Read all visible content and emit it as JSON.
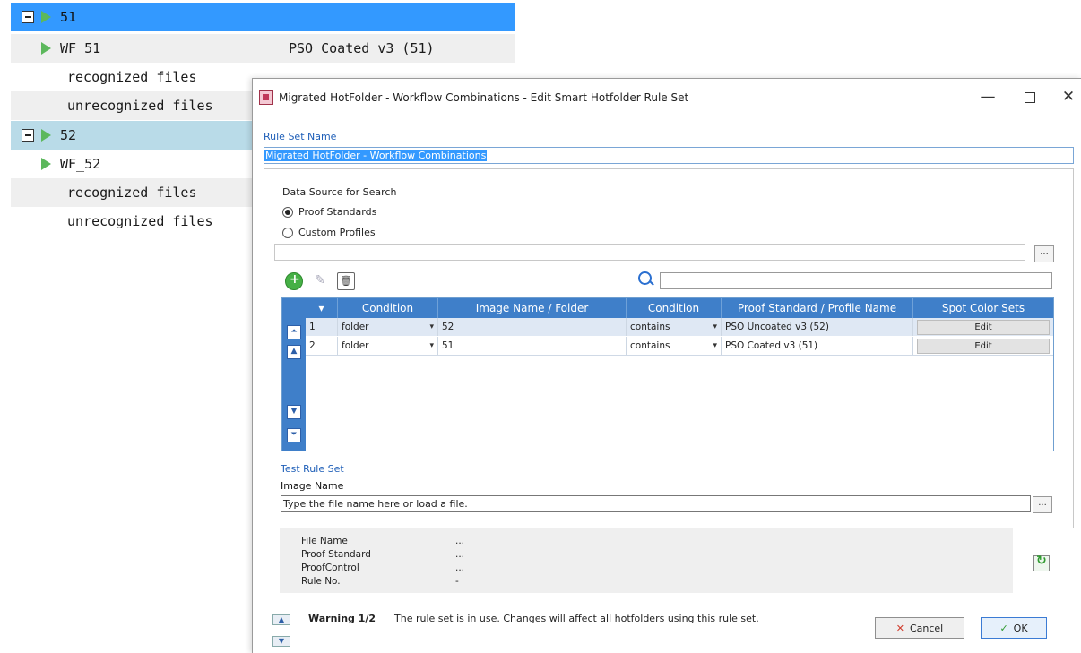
{
  "tree": {
    "rows": [
      {
        "label": "51",
        "value": ""
      },
      {
        "label": "WF_51",
        "value": "PSO Coated v3 (51)"
      },
      {
        "label": "recognized files"
      },
      {
        "label": "unrecognized files"
      },
      {
        "label": "52"
      },
      {
        "label": "WF_52"
      },
      {
        "label": "recognized files"
      },
      {
        "label": "unrecognized files"
      }
    ]
  },
  "dialog": {
    "title": "Migrated HotFolder - Workflow Combinations - Edit Smart Hotfolder Rule Set",
    "minimize": "—",
    "close": "✕",
    "rule_set_name_label": "Rule Set Name",
    "rule_set_name_value": "Migrated HotFolder - Workflow Combinations",
    "data_source_label": "Data Source for Search",
    "radio_proof_standards": "Proof Standards",
    "radio_custom_profiles": "Custom Profiles",
    "dots": "...",
    "grid": {
      "headers": [
        "Condition",
        "Image Name / Folder",
        "Condition",
        "Proof Standard / Profile Name",
        "Spot Color Sets"
      ],
      "rows": [
        {
          "num": "1",
          "cond1": "folder",
          "name": "52",
          "cond2": "contains",
          "proof": "PSO Uncoated v3 (52)",
          "edit": "Edit"
        },
        {
          "num": "2",
          "cond1": "folder",
          "name": "51",
          "cond2": "contains",
          "proof": "PSO Coated v3 (51)",
          "edit": "Edit"
        }
      ]
    },
    "test_rule_set_label": "Test Rule Set",
    "image_name_label": "Image Name",
    "image_name_value": "Type the file name here or load a file.",
    "results": [
      {
        "key": "File Name",
        "value": "..."
      },
      {
        "key": "Proof Standard",
        "value": "..."
      },
      {
        "key": "ProofControl",
        "value": "..."
      },
      {
        "key": "Rule No.",
        "value": "-"
      }
    ],
    "warning_bold": "Warning 1/2",
    "warning_text": "The rule set is in use. Changes will affect all hotfolders using this rule set.",
    "cancel_label": "Cancel",
    "ok_label": "OK"
  },
  "colors": {
    "selection": "#3399ff",
    "grid_header": "#3f7fc9",
    "label_blue": "#1f5fb8"
  }
}
